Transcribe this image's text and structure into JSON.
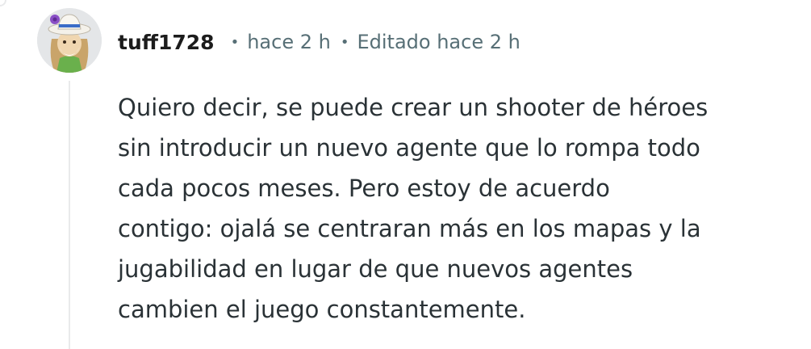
{
  "comment": {
    "author": "tuff1728",
    "separator": "•",
    "posted_time": "hace 2 h",
    "edited_label": "Editado hace 2 h",
    "body_lines": [
      "Quiero decir, se puede crear un shooter de héroes",
      "sin introducir un nuevo agente que lo rompa todo",
      "cada pocos meses. Pero estoy de acuerdo",
      "contigo: ojalá se centraran más en los mapas y la",
      "jugabilidad en lugar de que nuevos agentes",
      "cambien el juego constantemente."
    ]
  },
  "colors": {
    "meta_text": "#576f76",
    "thread_line": "#e9eaeb",
    "body_text": "#2a3236",
    "avatar_background": "#e4e6e8"
  },
  "icons": {
    "avatar": "user-avatar-icon"
  }
}
